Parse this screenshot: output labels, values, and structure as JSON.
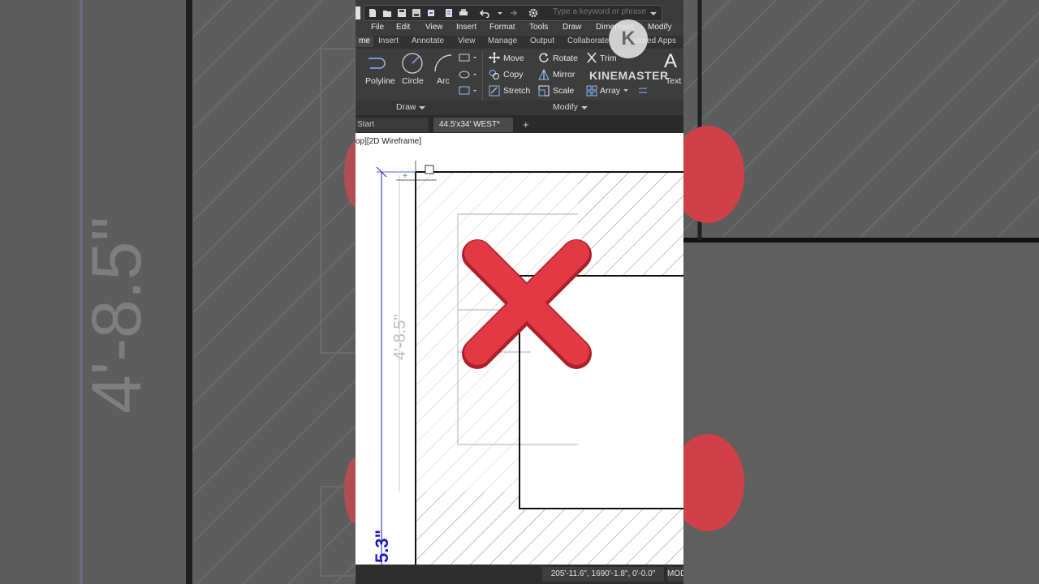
{
  "menu": [
    "File",
    "Edit",
    "View",
    "Insert",
    "Format",
    "Tools",
    "Draw",
    "Dimension",
    "Modify"
  ],
  "ribbon_tabs": [
    "me",
    "Insert",
    "Annotate",
    "View",
    "Manage",
    "Output",
    "Collaborate",
    "Featured Apps"
  ],
  "draw_tools": {
    "polyline": "Polyline",
    "circle": "Circle",
    "arc": "Arc",
    "group": "Draw"
  },
  "modify_tools": {
    "move": "Move",
    "copy": "Copy",
    "stretch": "Stretch",
    "rotate": "Rotate",
    "mirror": "Mirror",
    "scale": "Scale",
    "trim": "Trim",
    "array": "Array",
    "group": "Modify"
  },
  "text_tool": {
    "glyph": "A",
    "label": "Text"
  },
  "search_placeholder": "Type a keyword or phrase",
  "doc_tabs": {
    "start": "Start",
    "current": "44.5'x34' WEST*",
    "add": "+"
  },
  "viewport_label": "op][2D Wireframe]",
  "dimensions": {
    "vertical": "4'-8.5\"",
    "left": "5.3\""
  },
  "status": {
    "coords": "205'-11.6\", 1690'-1.8\", 0'-0.0\"",
    "mode": "MOD"
  },
  "watermark": {
    "text": "KINEMASTER",
    "logo_letter": "K"
  },
  "colors": {
    "ribbon_bg": "#3d3d3d",
    "x_mark": "#e23a45",
    "dim_blue": "#1a1acc"
  }
}
